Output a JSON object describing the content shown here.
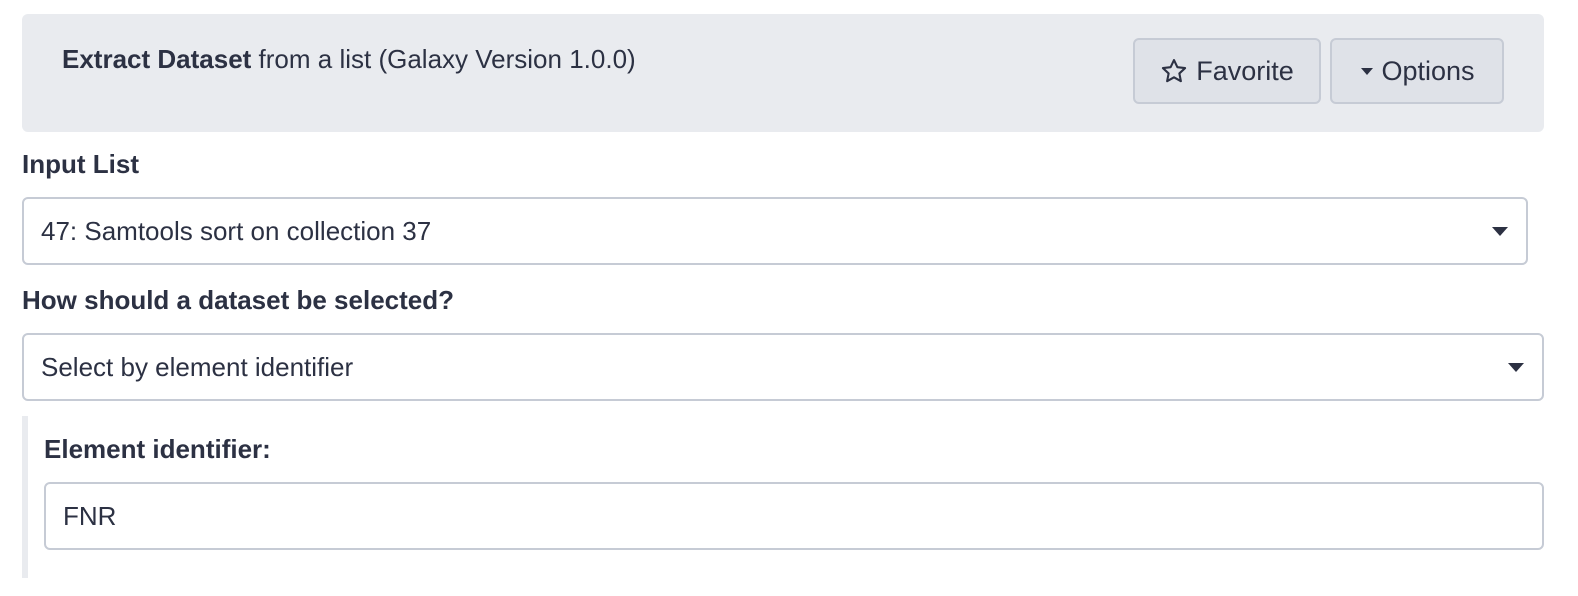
{
  "tool": {
    "name": "Extract Dataset",
    "description": "from a list (Galaxy Version 1.0.0)"
  },
  "buttons": {
    "favorite": "Favorite",
    "options": "Options"
  },
  "icons": {
    "favorite": "star-outline-icon",
    "options": "caret-down-icon"
  },
  "form": {
    "input_list": {
      "label": "Input List",
      "value": "47: Samtools sort on collection 37"
    },
    "selection_mode": {
      "label": "How should a dataset be selected?",
      "value": "Select by element identifier"
    },
    "element_identifier": {
      "label": "Element identifier:",
      "value": "FNR"
    }
  },
  "colors": {
    "header_bg": "#e9ebef",
    "button_bg": "#dfe2e8",
    "border": "#c6cbd5",
    "text": "#2c3143"
  }
}
